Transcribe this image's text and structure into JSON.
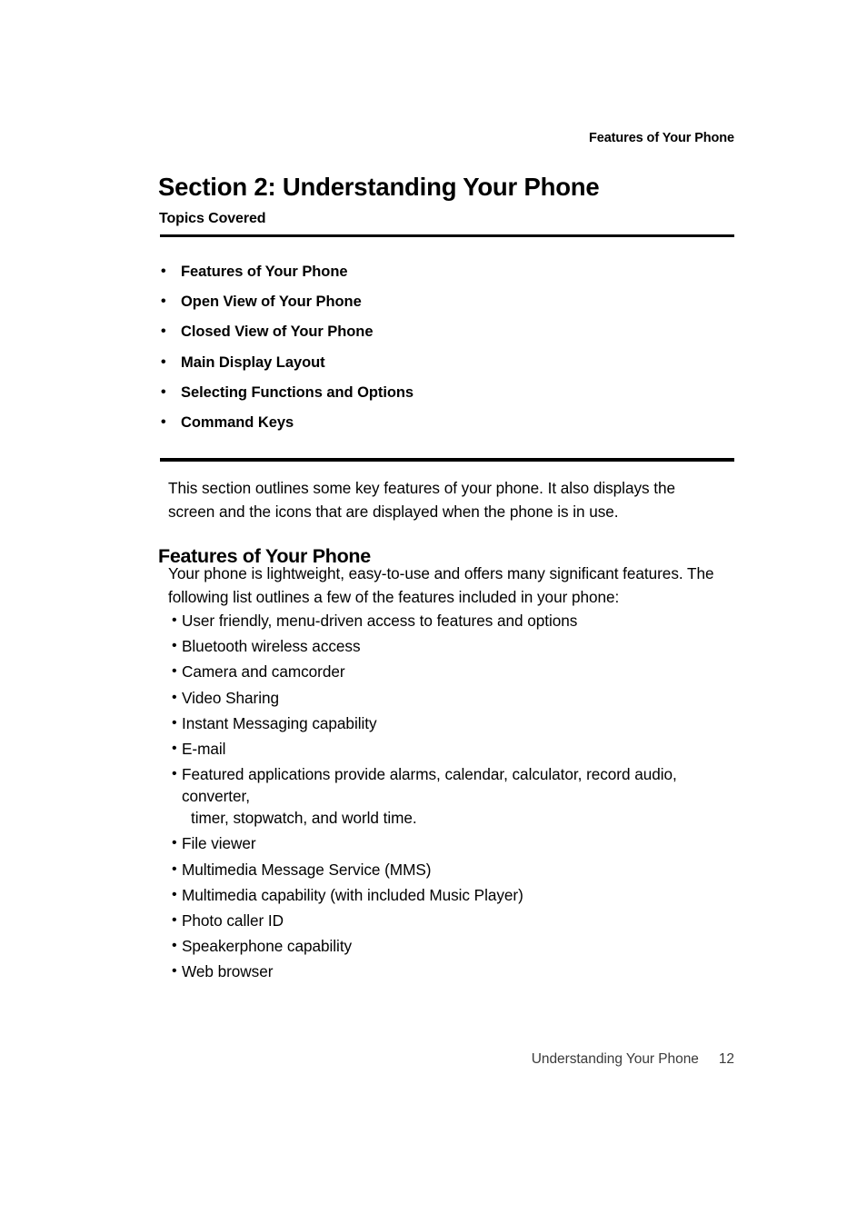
{
  "header": {
    "running_head": "Features of Your Phone"
  },
  "title": "Section 2: Understanding Your Phone",
  "topics": {
    "label": "Topics Covered",
    "items": [
      "Features of Your Phone",
      "Open View of Your Phone",
      "Closed View of Your Phone",
      "Main Display Layout",
      "Selecting Functions and Options",
      "Command Keys"
    ]
  },
  "intro": "This section outlines some key features of your phone. It also displays the screen and the icons that are displayed when the phone is in use.",
  "features_section": {
    "heading": "Features of Your Phone",
    "intro": "Your phone is lightweight, easy-to-use and offers many significant features. The following list outlines a few of the features included in your phone:",
    "items": [
      "User friendly, menu-driven access to features and options",
      "Bluetooth wireless access",
      "Camera and camcorder",
      "Video Sharing",
      "Instant Messaging capability",
      "E-mail",
      "Featured applications provide alarms, calendar, calculator, record audio, converter,",
      "File viewer",
      "Multimedia Message Service (MMS)",
      "Multimedia capability (with included Music Player)",
      "Photo caller ID",
      "Speakerphone capability",
      "Web browser"
    ],
    "item_7_continuation": "timer, stopwatch, and world time."
  },
  "footer": {
    "section_name": "Understanding Your Phone",
    "page_number": "12"
  }
}
